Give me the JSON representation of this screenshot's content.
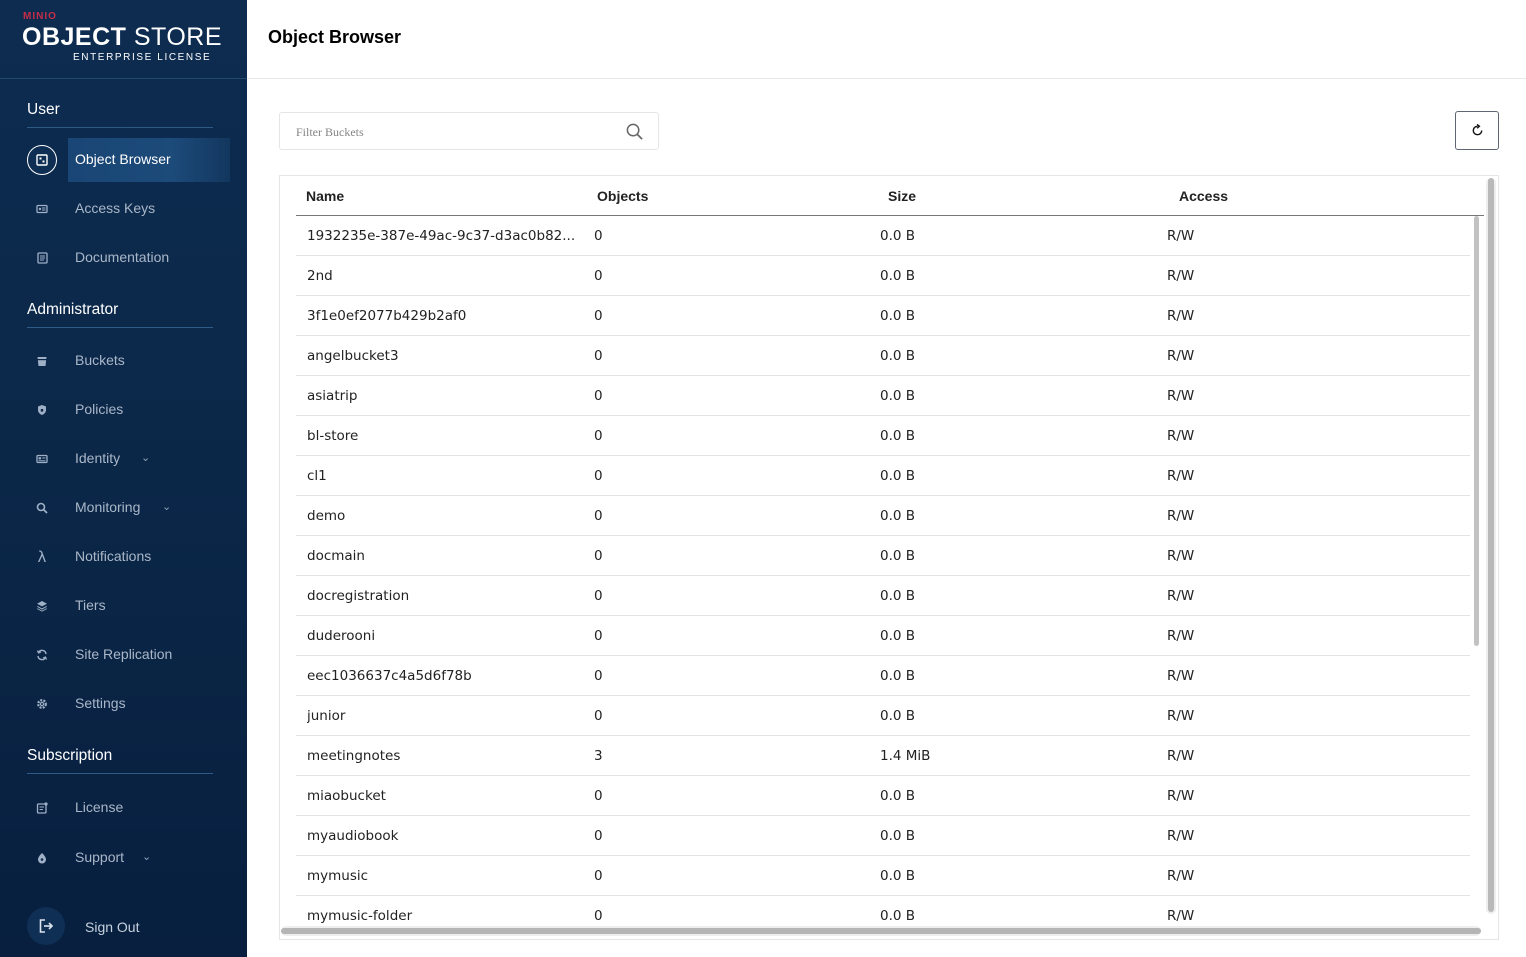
{
  "logo": {
    "small": "MINIO",
    "big_bold": "OBJECT",
    "big_light": " STORE",
    "sub": "ENTERPRISE LICENSE"
  },
  "sidebar": {
    "sections": {
      "user": "User",
      "administrator": "Administrator",
      "subscription": "Subscription"
    },
    "items": {
      "object_browser": {
        "label": "Object Browser",
        "icon": "object-browser-icon",
        "active": true
      },
      "access_keys": {
        "label": "Access Keys",
        "icon": "key-icon"
      },
      "documentation": {
        "label": "Documentation",
        "icon": "document-icon"
      },
      "buckets": {
        "label": "Buckets",
        "icon": "bucket-icon"
      },
      "policies": {
        "label": "Policies",
        "icon": "shield-icon"
      },
      "identity": {
        "label": "Identity",
        "icon": "id-card-icon",
        "expandable": true
      },
      "monitoring": {
        "label": "Monitoring",
        "icon": "magnifier-icon",
        "expandable": true
      },
      "notifications": {
        "label": "Notifications",
        "icon": "lambda-icon"
      },
      "tiers": {
        "label": "Tiers",
        "icon": "layers-icon"
      },
      "site_replication": {
        "label": "Site Replication",
        "icon": "sync-icon"
      },
      "settings": {
        "label": "Settings",
        "icon": "gear-icon"
      },
      "license": {
        "label": "License",
        "icon": "license-icon"
      },
      "support": {
        "label": "Support",
        "icon": "support-icon",
        "expandable": true
      }
    },
    "sign_out": "Sign Out"
  },
  "header": {
    "title": "Object Browser"
  },
  "search": {
    "placeholder": "Filter Buckets",
    "value": ""
  },
  "table": {
    "columns": {
      "name": "Name",
      "objects": "Objects",
      "size": "Size",
      "access": "Access"
    },
    "rows": [
      {
        "name": "1932235e-387e-49ac-9c37-d3ac0b82...",
        "objects": "0",
        "size": "0.0 B",
        "access": "R/W"
      },
      {
        "name": "2nd",
        "objects": "0",
        "size": "0.0 B",
        "access": "R/W"
      },
      {
        "name": "3f1e0ef2077b429b2af0",
        "objects": "0",
        "size": "0.0 B",
        "access": "R/W"
      },
      {
        "name": "angelbucket3",
        "objects": "0",
        "size": "0.0 B",
        "access": "R/W"
      },
      {
        "name": "asiatrip",
        "objects": "0",
        "size": "0.0 B",
        "access": "R/W"
      },
      {
        "name": "bl-store",
        "objects": "0",
        "size": "0.0 B",
        "access": "R/W"
      },
      {
        "name": "cl1",
        "objects": "0",
        "size": "0.0 B",
        "access": "R/W"
      },
      {
        "name": "demo",
        "objects": "0",
        "size": "0.0 B",
        "access": "R/W"
      },
      {
        "name": "docmain",
        "objects": "0",
        "size": "0.0 B",
        "access": "R/W"
      },
      {
        "name": "docregistration",
        "objects": "0",
        "size": "0.0 B",
        "access": "R/W"
      },
      {
        "name": "duderooni",
        "objects": "0",
        "size": "0.0 B",
        "access": "R/W"
      },
      {
        "name": "eec1036637c4a5d6f78b",
        "objects": "0",
        "size": "0.0 B",
        "access": "R/W"
      },
      {
        "name": "junior",
        "objects": "0",
        "size": "0.0 B",
        "access": "R/W"
      },
      {
        "name": "meetingnotes",
        "objects": "3",
        "size": "1.4 MiB",
        "access": "R/W"
      },
      {
        "name": "miaobucket",
        "objects": "0",
        "size": "0.0 B",
        "access": "R/W"
      },
      {
        "name": "myaudiobook",
        "objects": "0",
        "size": "0.0 B",
        "access": "R/W"
      },
      {
        "name": "mymusic",
        "objects": "0",
        "size": "0.0 B",
        "access": "R/W"
      },
      {
        "name": "mymusic-folder",
        "objects": "0",
        "size": "0.0 B",
        "access": "R/W"
      }
    ]
  },
  "colors": {
    "sidebar_bg": "#0b2748",
    "brand_red": "#c72c48",
    "active_item_bg": "#1c4a79"
  }
}
